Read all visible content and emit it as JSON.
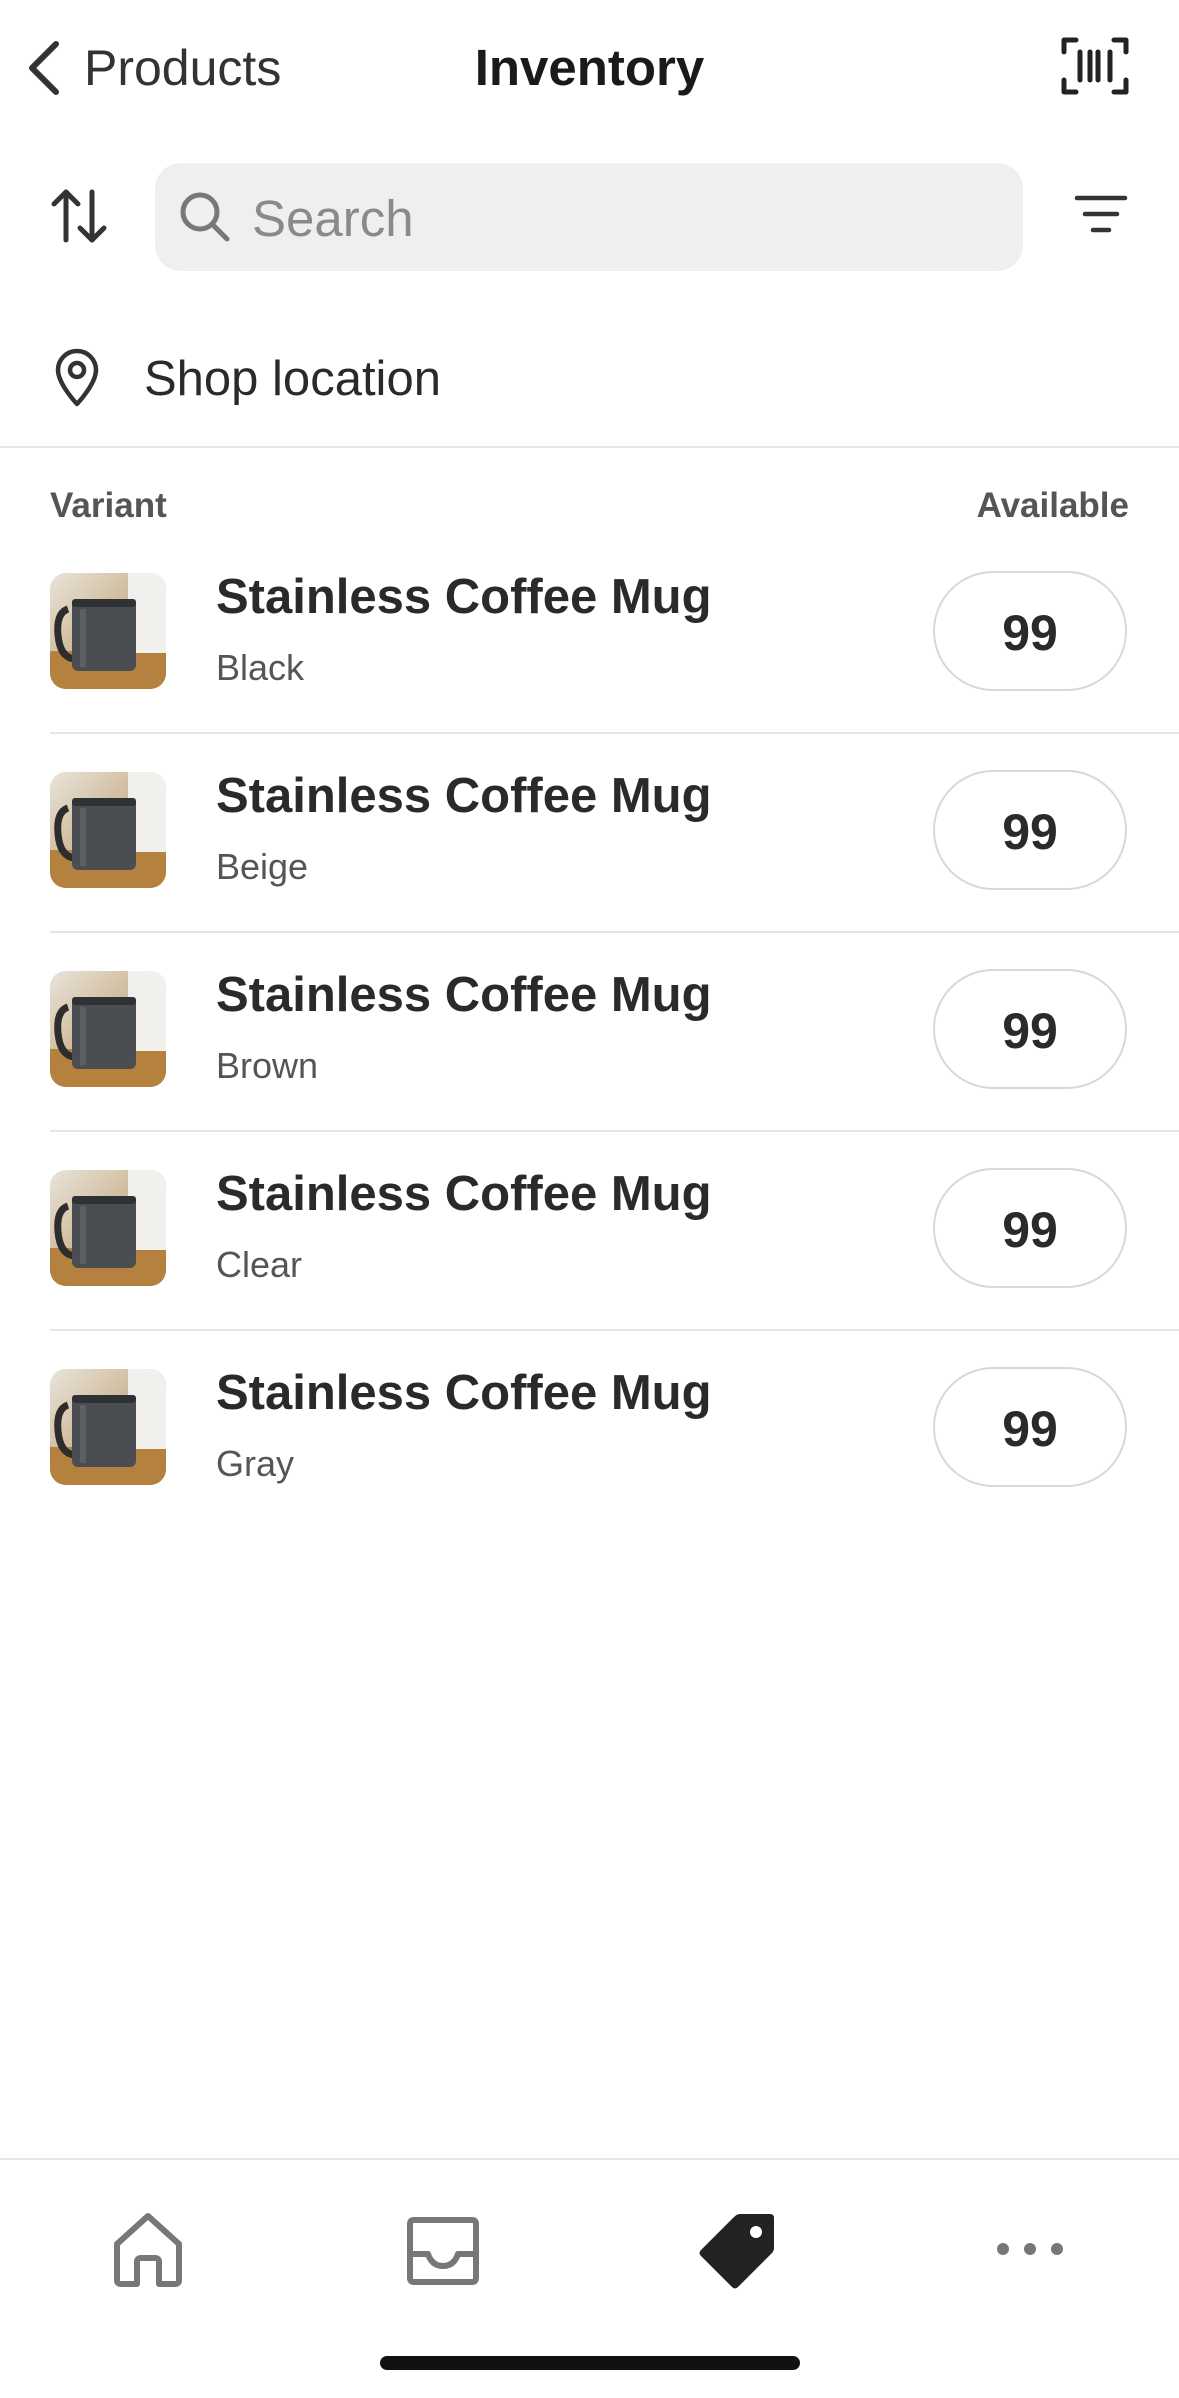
{
  "header": {
    "back_label": "Products",
    "title": "Inventory"
  },
  "search": {
    "placeholder": "Search"
  },
  "location": {
    "label": "Shop location"
  },
  "columns": {
    "variant": "Variant",
    "available": "Available"
  },
  "items": [
    {
      "name": "Stainless Coffee Mug",
      "variant": "Black",
      "available": "99"
    },
    {
      "name": "Stainless Coffee Mug",
      "variant": "Beige",
      "available": "99"
    },
    {
      "name": "Stainless Coffee Mug",
      "variant": "Brown",
      "available": "99"
    },
    {
      "name": "Stainless Coffee Mug",
      "variant": "Clear",
      "available": "99"
    },
    {
      "name": "Stainless Coffee Mug",
      "variant": "Gray",
      "available": "99"
    }
  ],
  "tabs": [
    {
      "icon": "home-icon",
      "active": false
    },
    {
      "icon": "inbox-icon",
      "active": false
    },
    {
      "icon": "tag-icon",
      "active": true
    },
    {
      "icon": "more-icon",
      "active": false
    }
  ]
}
